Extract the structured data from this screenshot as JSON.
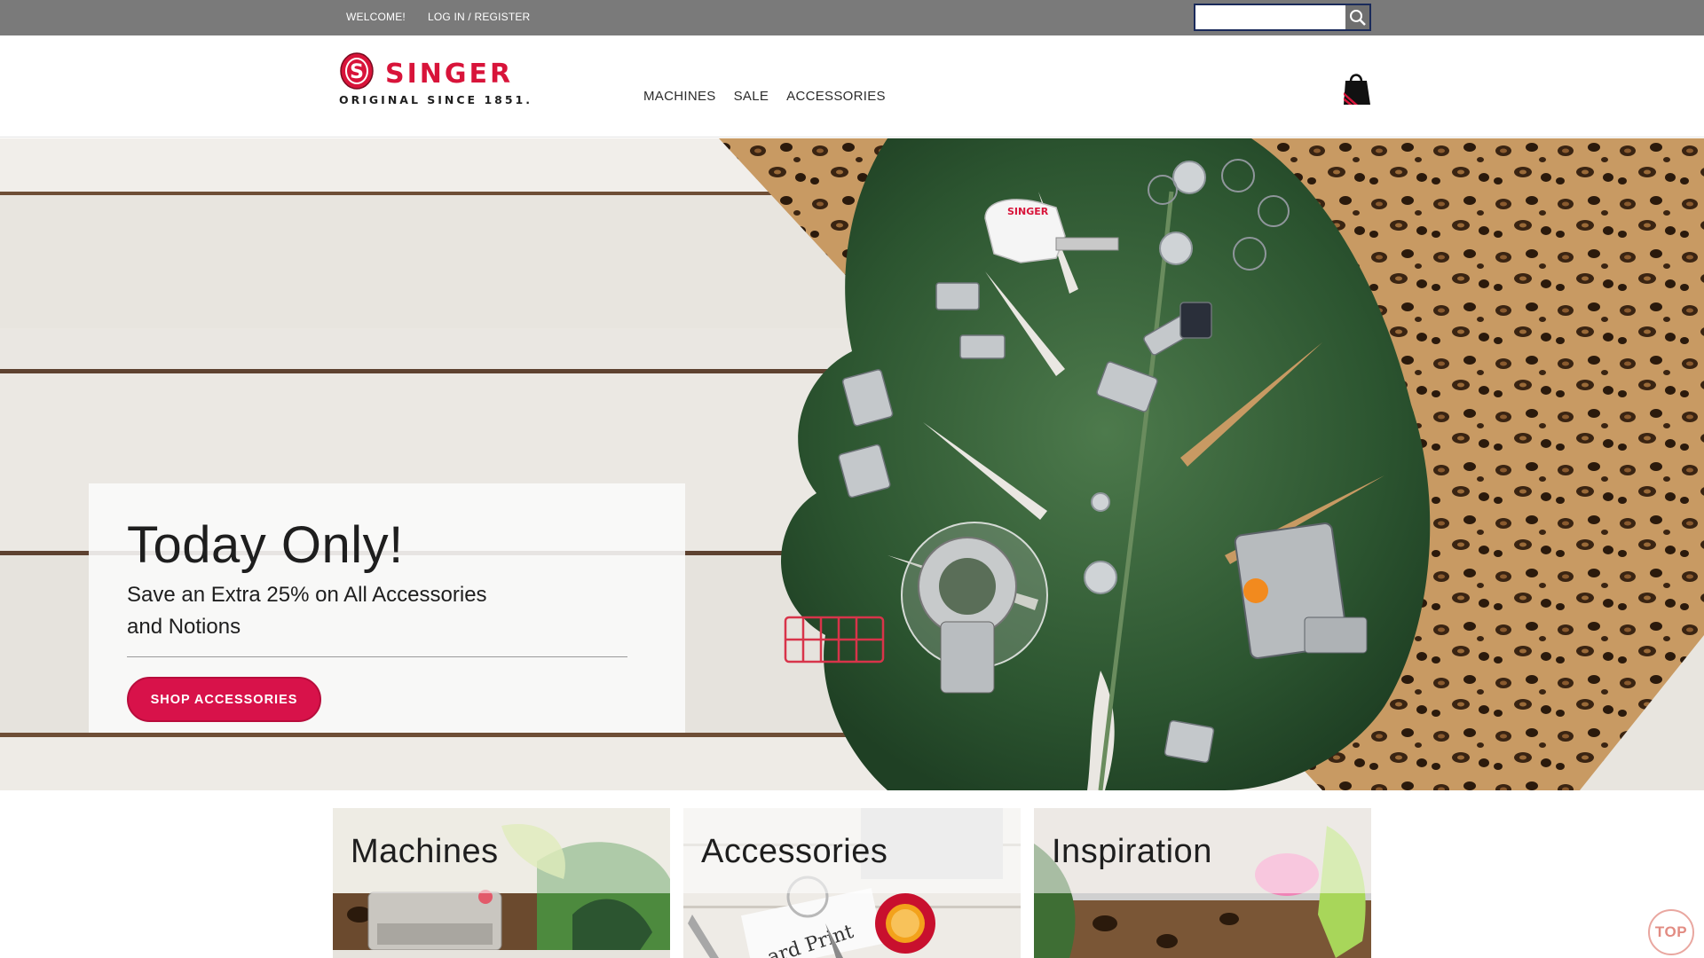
{
  "topbar": {
    "welcome": "WELCOME!",
    "login_register": "LOG IN / REGISTER",
    "search": {
      "placeholder": "",
      "value": "",
      "icon": "search-icon"
    }
  },
  "header": {
    "logo": {
      "wordmark": "SINGER",
      "tagline": "ORIGINAL SINCE 1851.",
      "emblem_letter": "S"
    },
    "nav": [
      "MACHINES",
      "SALE",
      "ACCESSORIES"
    ],
    "cart_icon": "shopping-bag-icon"
  },
  "hero": {
    "title": "Today Only!",
    "subtitle": "Save an Extra 25% on All Accessories and Notions",
    "button": "SHOP ACCESSORIES",
    "image_logo_text": "SINGER"
  },
  "categories": [
    {
      "label": "Machines"
    },
    {
      "label": "Accessories"
    },
    {
      "label": "Inspiration"
    }
  ],
  "back_to_top": "TOP",
  "colors": {
    "brand_red": "#d8143a",
    "button_red": "#d8124a",
    "topbar_gray": "#7a7a7a",
    "leaf_green": "#2f5a34"
  }
}
